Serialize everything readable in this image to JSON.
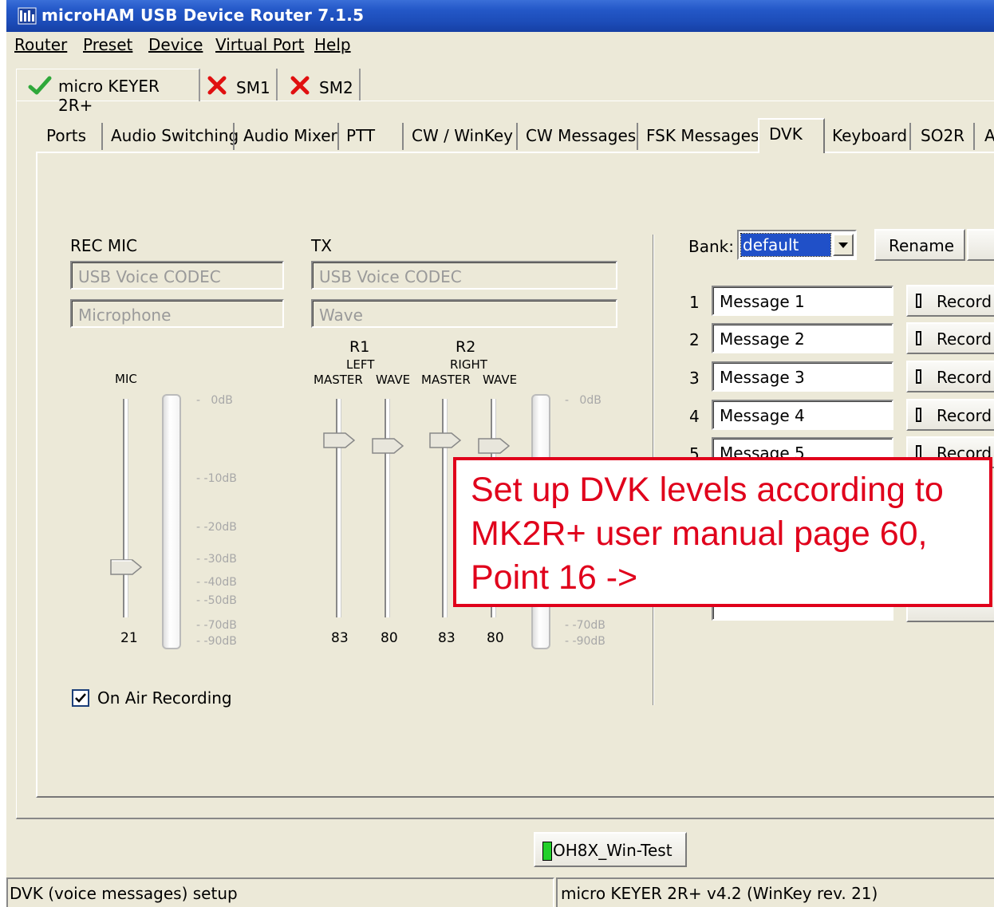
{
  "window": {
    "title": "microHAM USB Device Router 7.1.5"
  },
  "menu": [
    "Router",
    "Preset",
    "Device",
    "Virtual Port",
    "Help"
  ],
  "device_tabs": [
    {
      "label": "micro KEYER 2R+",
      "status": "ok"
    },
    {
      "label": "SM1",
      "status": "error"
    },
    {
      "label": "SM2",
      "status": "error"
    }
  ],
  "sub_tabs": [
    "Ports",
    "Audio Switching",
    "Audio Mixer",
    "PTT",
    "CW / WinKey",
    "CW Messages",
    "FSK Messages",
    "DVK",
    "Keyboard",
    "SO2R",
    "A"
  ],
  "active_sub_tab": "DVK",
  "rec_mic": {
    "label": "REC MIC",
    "device": "USB Voice CODEC",
    "source": "Microphone"
  },
  "tx": {
    "label": "TX",
    "device": "USB Voice CODEC",
    "source": "Wave"
  },
  "mic_slider": {
    "label": "MIC",
    "value": "21"
  },
  "r1": {
    "label": "R1",
    "side": "LEFT",
    "master_label": "MASTER",
    "wave_label": "WAVE",
    "master_value": "83",
    "wave_value": "80"
  },
  "r2": {
    "label": "R2",
    "side": "RIGHT",
    "master_label": "MASTER",
    "wave_label": "WAVE",
    "master_value": "83",
    "wave_value": "80"
  },
  "db_scale_left": [
    "0dB",
    "-10dB",
    "-20dB",
    "-30dB",
    "-40dB",
    "-50dB",
    "-70dB",
    "-90dB"
  ],
  "db_scale_right": [
    "0dB",
    "-70dB",
    "-90dB"
  ],
  "on_air_recording": {
    "label": "On Air Recording",
    "checked": true
  },
  "bank": {
    "label": "Bank:",
    "value": "default",
    "rename_label": "Rename"
  },
  "messages": [
    {
      "num": "1",
      "name": "Message 1",
      "button": "Record"
    },
    {
      "num": "2",
      "name": "Message 2",
      "button": "Record"
    },
    {
      "num": "3",
      "name": "Message 3",
      "button": "Record"
    },
    {
      "num": "4",
      "name": "Message 4",
      "button": "Record"
    },
    {
      "num": "5",
      "name": "Message 5",
      "button": "Record"
    }
  ],
  "callout": {
    "text": "Set up DVK levels according to MK2R+ user manual page 60, Point 16 ->"
  },
  "preset_button": {
    "label": "OH8X_Win-Test"
  },
  "status": {
    "left": "DVK (voice messages) setup",
    "right": "micro KEYER 2R+ v4.2 (WinKey rev. 21)"
  }
}
